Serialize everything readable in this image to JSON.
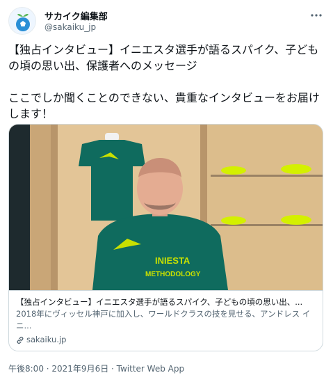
{
  "account": {
    "display_name": "サカイク編集部",
    "handle": "@sakaiku_jp",
    "avatar_icon": "soccer-ball-sprout-icon"
  },
  "more_icon": "more-dots-icon",
  "tweet": {
    "text": "【独占インタビュー】イニエスタ選手が語るスパイク、子どもの頃の思い出、保護者へのメッセージ\n\nここでしか聞くことのできない、貴重なインタビューをお届けします！"
  },
  "card": {
    "shirt_logo_line1": "INIESTA",
    "shirt_logo_line2": "METHODOLOGY",
    "title": "【独占インタビュー】イニエスタ選手が語るスパイク、子どもの頃の思い出、...",
    "description": "2018年にヴィッセル神戸に加入し、ワールドクラスの技を見せる、アンドレス イニ...",
    "domain": "sakaiku.jp",
    "domain_icon": "link-icon"
  },
  "meta": {
    "timestamp": "午後8:00 · 2021年9月6日 · Twitter Web App"
  },
  "colors": {
    "jersey": "#0f6b5e",
    "accent_yellow": "#c8e000",
    "text_primary": "#0f1419",
    "text_secondary": "#536471",
    "border": "#cfd9de"
  }
}
